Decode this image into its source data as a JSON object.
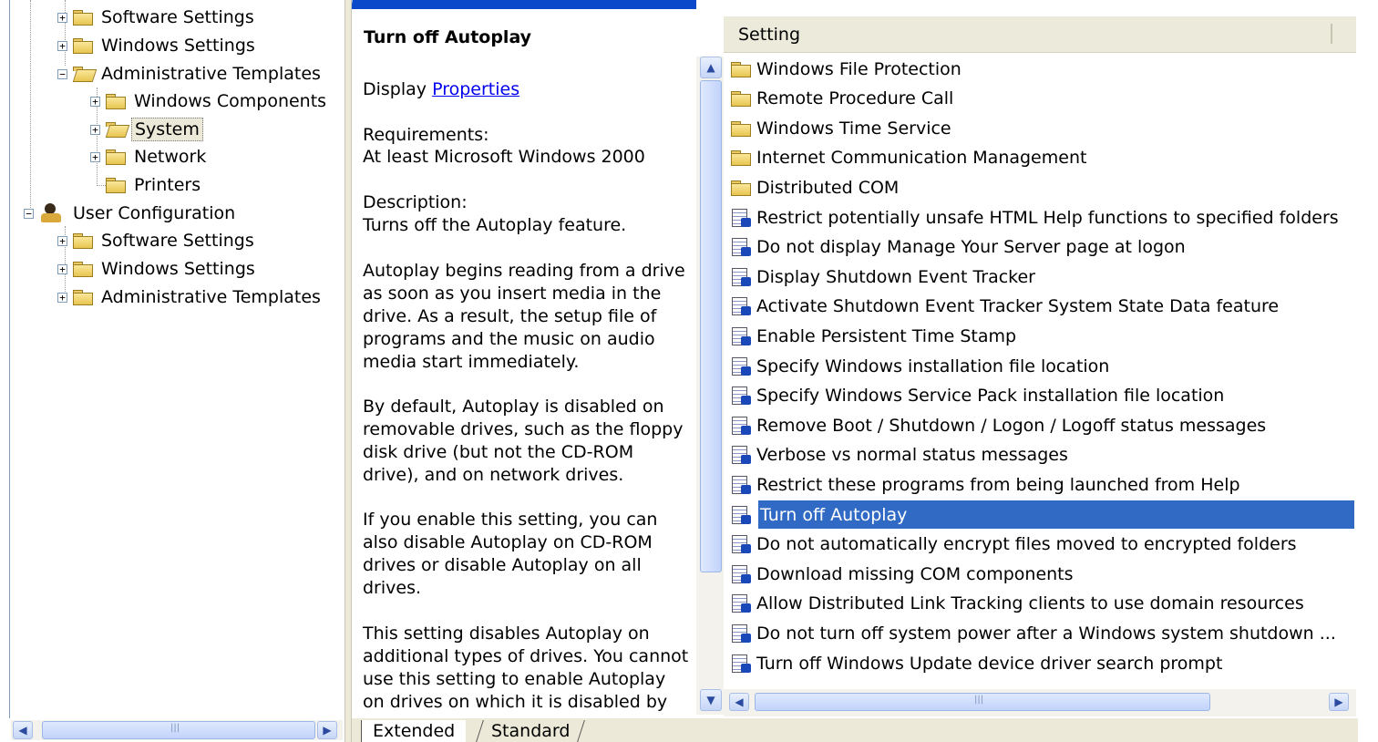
{
  "tree": {
    "nodes": [
      {
        "label": "Software Settings",
        "expander": "+"
      },
      {
        "label": "Windows Settings",
        "expander": "+"
      },
      {
        "label": "Administrative Templates",
        "expander": "−"
      },
      {
        "label": "Windows Components",
        "expander": "+"
      },
      {
        "label": "System",
        "expander": "+"
      },
      {
        "label": "Network",
        "expander": "+"
      },
      {
        "label": "Printers",
        "expander": ""
      },
      {
        "label": "User Configuration",
        "expander": "−"
      },
      {
        "label": "Software Settings",
        "expander": "+"
      },
      {
        "label": "Windows Settings",
        "expander": "+"
      },
      {
        "label": "Administrative Templates",
        "expander": "+"
      }
    ],
    "selected": "System"
  },
  "description": {
    "title": "Turn off Autoplay",
    "display_prefix": "Display",
    "display_link": "Properties",
    "requirements_label": "Requirements:",
    "requirements_value": "At least Microsoft Windows 2000",
    "description_label": "Description:",
    "description_lead": "Turns off the Autoplay feature.",
    "para1": "Autoplay begins reading from a drive as soon as you insert media in the drive. As a result, the setup file of programs and the music on audio media start immediately.",
    "para2": "By default, Autoplay is disabled on removable drives, such as the floppy disk drive (but not the CD-ROM drive), and on network drives.",
    "para3": "If you enable this setting, you can also disable Autoplay on CD-ROM drives or disable Autoplay on all drives.",
    "para4": "This setting disables Autoplay on additional types of drives. You cannot use this setting to enable Autoplay on drives on which it is disabled by"
  },
  "list": {
    "header": "Setting",
    "selected": "Turn off Autoplay",
    "rows": [
      {
        "label": "Windows File Protection",
        "kind": "folder"
      },
      {
        "label": "Remote Procedure Call",
        "kind": "folder"
      },
      {
        "label": "Windows Time Service",
        "kind": "folder"
      },
      {
        "label": "Internet Communication Management",
        "kind": "folder"
      },
      {
        "label": "Distributed COM",
        "kind": "folder"
      },
      {
        "label": "Restrict potentially unsafe HTML Help functions to specified folders",
        "kind": "setting"
      },
      {
        "label": "Do not display Manage Your Server page at logon",
        "kind": "setting"
      },
      {
        "label": "Display Shutdown Event Tracker",
        "kind": "setting"
      },
      {
        "label": "Activate Shutdown Event Tracker System State Data feature",
        "kind": "setting"
      },
      {
        "label": "Enable Persistent Time Stamp",
        "kind": "setting"
      },
      {
        "label": "Specify Windows installation file location",
        "kind": "setting"
      },
      {
        "label": "Specify Windows Service Pack installation file location",
        "kind": "setting"
      },
      {
        "label": "Remove Boot / Shutdown / Logon / Logoff status messages",
        "kind": "setting"
      },
      {
        "label": "Verbose vs normal status messages",
        "kind": "setting"
      },
      {
        "label": "Restrict these programs from being launched from Help",
        "kind": "setting"
      },
      {
        "label": "Turn off Autoplay",
        "kind": "setting"
      },
      {
        "label": "Do not automatically encrypt files moved to encrypted folders",
        "kind": "setting"
      },
      {
        "label": "Download missing COM components",
        "kind": "setting"
      },
      {
        "label": "Allow Distributed Link Tracking clients to use domain resources",
        "kind": "setting"
      },
      {
        "label": "Do not turn off system power after a Windows system shutdown ...",
        "kind": "setting"
      },
      {
        "label": "Turn off Windows Update device driver search prompt",
        "kind": "setting"
      }
    ]
  },
  "tabs": {
    "extended": "Extended",
    "standard": "Standard",
    "active": "Extended"
  },
  "icons": {
    "scroll_left": "◀",
    "scroll_right": "▶",
    "scroll_up": "▲",
    "scroll_down": "▼",
    "grip": "|||"
  },
  "colors": {
    "selection": "#316ac5",
    "link": "#0000ee",
    "chrome": "#ece9d8"
  }
}
